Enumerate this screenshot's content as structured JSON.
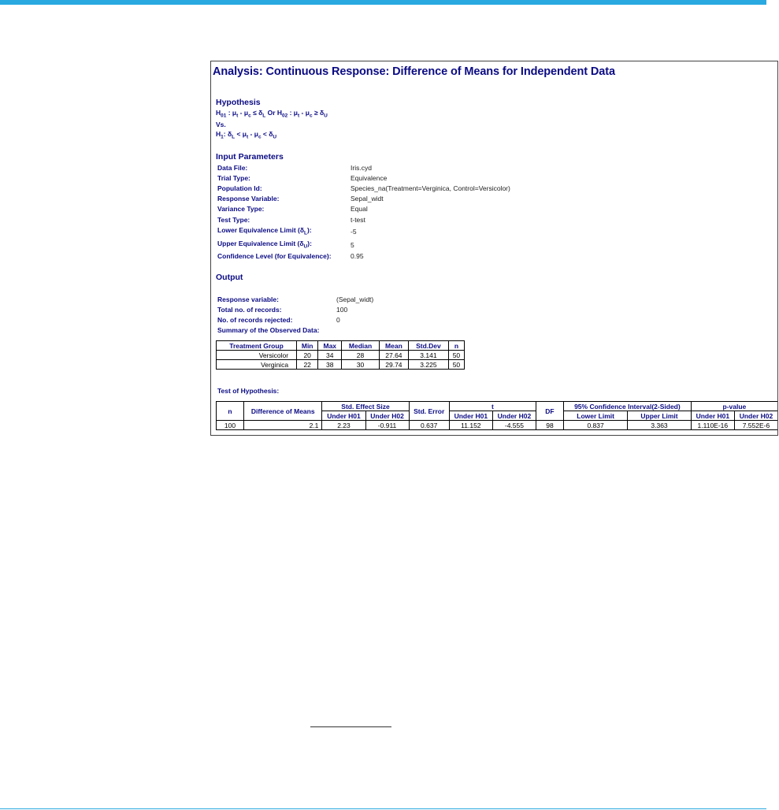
{
  "report": {
    "title": "Analysis: Continuous Response: Difference of Means for Independent Data",
    "hypothesis": {
      "heading": "Hypothesis",
      "h0_parts": [
        "H",
        "01",
        " : μ",
        "t",
        " - μ",
        "c",
        " ≤ δ",
        "L",
        " Or H",
        "02",
        " : μ",
        "t",
        " - μ",
        "c",
        " ≥ δ",
        "U"
      ],
      "vs": "Vs.",
      "h1_parts": [
        "H",
        "1",
        ": δ",
        "L",
        " < μ",
        "t",
        " - μ",
        "c",
        " < δ",
        "U"
      ]
    },
    "input_parameters": {
      "heading": "Input Parameters",
      "rows": [
        {
          "label": "Data File:",
          "value": "Iris.cyd"
        },
        {
          "label": "Trial Type:",
          "value": "Equivalence"
        },
        {
          "label": "Population Id:",
          "value": "Species_na(Treatment=Verginica, Control=Versicolor)"
        },
        {
          "label": "Response Variable:",
          "value": "Sepal_widt"
        },
        {
          "label": "Variance Type:",
          "value": "Equal"
        },
        {
          "label": "Test Type:",
          "value": "t-test"
        }
      ],
      "lower_limit": {
        "label_a": "Lower Equivalence Limit (δ",
        "sub": "L",
        "label_b": "):",
        "value": "-5"
      },
      "upper_limit": {
        "label_a": "Upper Equivalence Limit (δ",
        "sub": "U",
        "label_b": "):",
        "value": "5"
      },
      "confidence": {
        "label": "Confidence Level (for Equivalence):",
        "value": "0.95"
      }
    },
    "output": {
      "heading": "Output",
      "rows": [
        {
          "label": "Response variable:",
          "value": "(Sepal_widt)"
        },
        {
          "label": "Total no. of records:",
          "value": "100"
        },
        {
          "label": "No. of records rejected:",
          "value": "0"
        }
      ],
      "summary_label": "Summary of the Observed Data:",
      "summary_table": {
        "headers": [
          "Treatment Group",
          "Min",
          "Max",
          "Median",
          "Mean",
          "Std.Dev",
          "n"
        ],
        "rows": [
          [
            "Versicolor",
            "20",
            "34",
            "28",
            "27.64",
            "3.141",
            "50"
          ],
          [
            "Verginica",
            "22",
            "38",
            "30",
            "29.74",
            "3.225",
            "50"
          ]
        ]
      },
      "test_label": "Test of Hypothesis:",
      "test_table": {
        "h_n": "n",
        "h_diff": "Difference of Means",
        "h_effect": "Std. Effect Size",
        "h_stderr": "Std. Error",
        "h_t": "t",
        "h_df": "DF",
        "h_ci": "95% Confidence Interval(2-Sided)",
        "h_p": "p-value",
        "sub_h01": "Under H01",
        "sub_h02": "Under H02",
        "sub_lower": "Lower Limit",
        "sub_upper": "Upper Limit",
        "row": [
          "100",
          "2.1",
          "2.23",
          "-0.911",
          "0.637",
          "11.152",
          "-4.555",
          "98",
          "0.837",
          "3.363",
          "1.110E-16",
          "7.552E-6"
        ]
      }
    }
  }
}
